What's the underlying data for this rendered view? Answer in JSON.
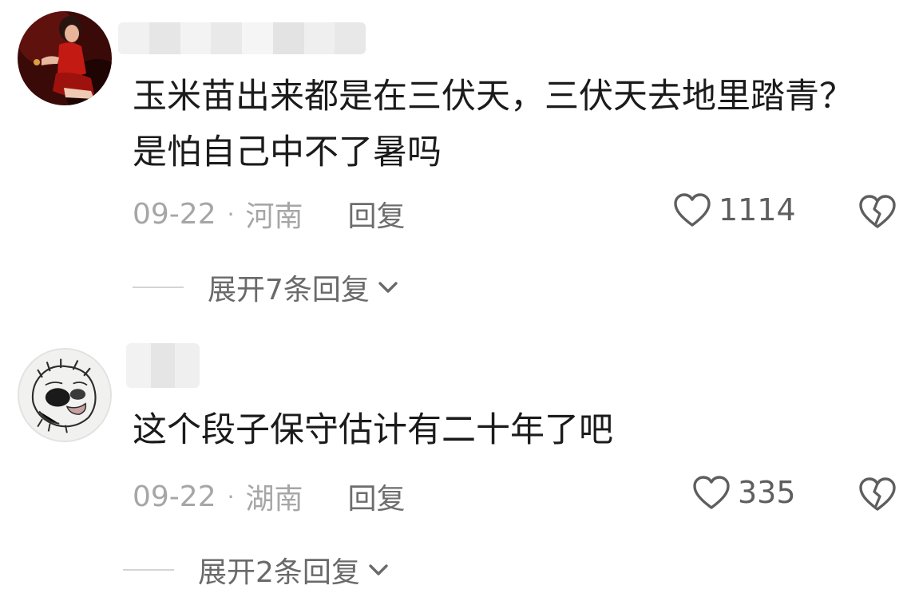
{
  "comments": [
    {
      "text": "玉米苗出来都是在三伏天，三伏天去地里踏青？是怕自己中不了暑吗",
      "date": "09-22",
      "separator": "·",
      "location": "河南",
      "reply_label": "回复",
      "likes": "1114",
      "expand_label": "展开7条回复"
    },
    {
      "text": "这个段子保守估计有二十年了吧",
      "date": "09-22",
      "separator": "·",
      "location": "湖南",
      "reply_label": "回复",
      "likes": "335",
      "expand_label": "展开2条回复"
    }
  ]
}
